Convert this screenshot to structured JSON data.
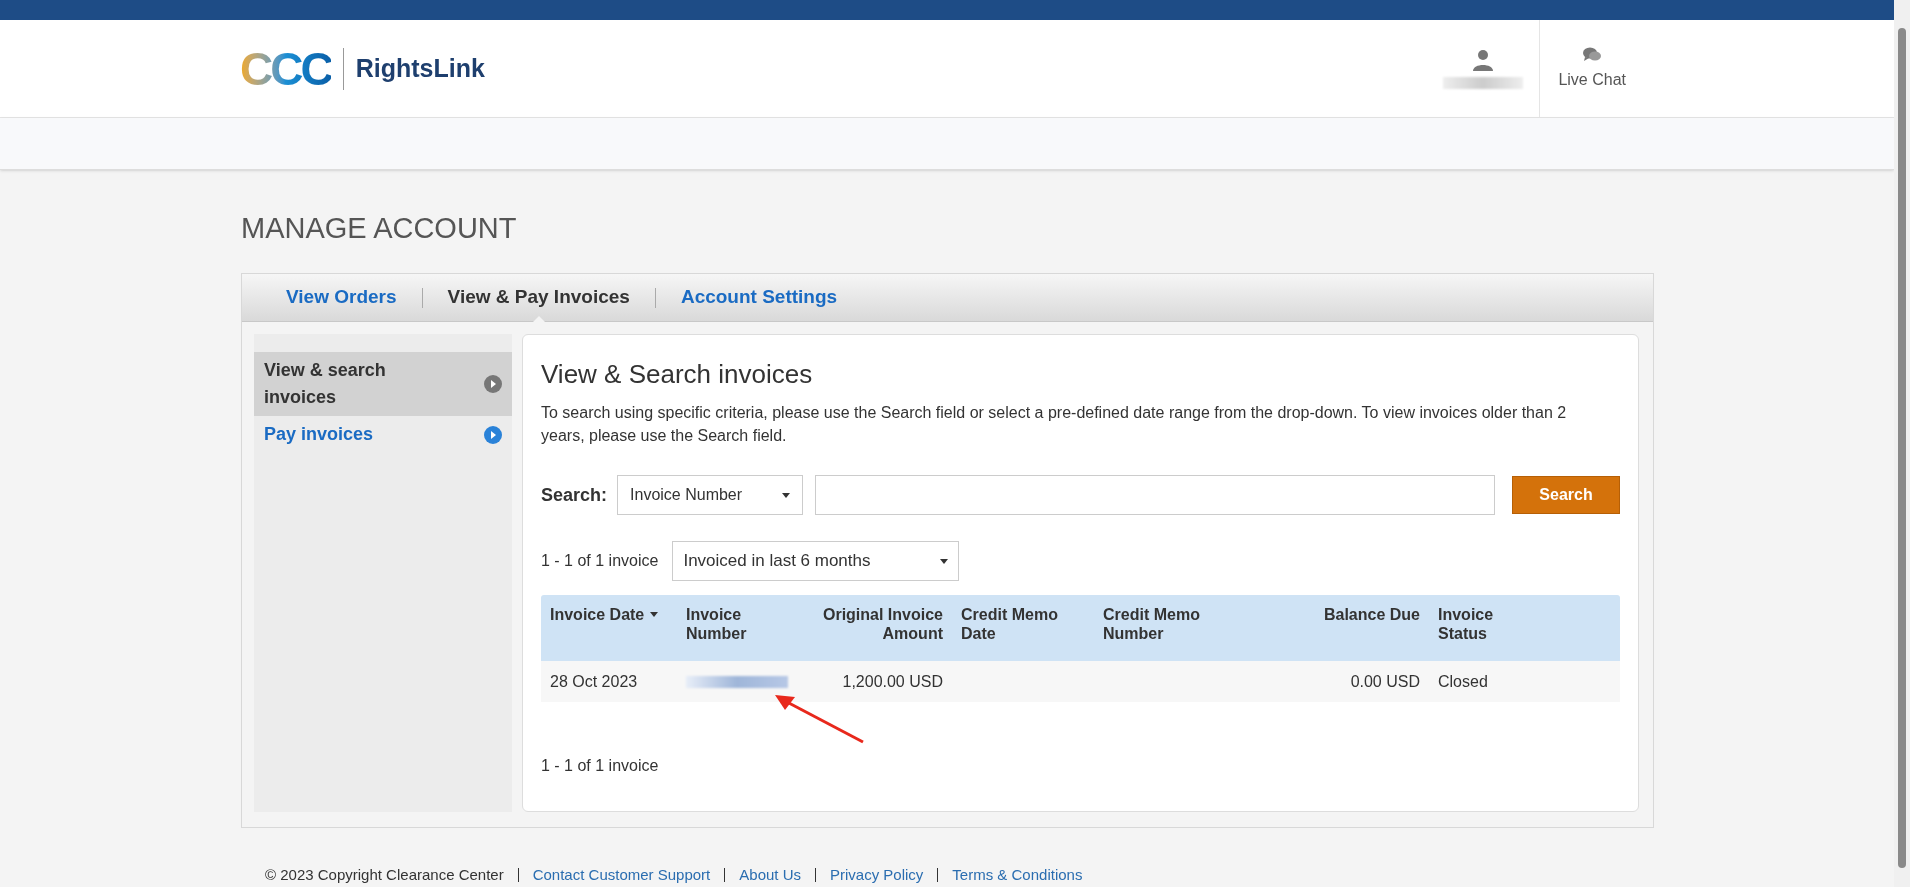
{
  "header": {
    "logo": {
      "mark": "CCC",
      "name": "RightsLink"
    },
    "user_menu": {
      "redacted": true
    },
    "live_chat": "Live Chat"
  },
  "page_title": "MANAGE ACCOUNT",
  "tabs": [
    {
      "label": "View Orders",
      "selected": false
    },
    {
      "label": "View & Pay Invoices",
      "selected": true
    },
    {
      "label": "Account Settings",
      "selected": false
    }
  ],
  "sidebar": {
    "items": [
      {
        "label": "View & search invoices",
        "selected": true
      },
      {
        "label": "Pay invoices",
        "selected": false
      }
    ]
  },
  "content": {
    "title": "View & Search invoices",
    "intro": "To search using specific criteria, please use the Search field or select a pre-defined date range from the drop-down. To view invoices older than 2 years, please use the Search field.",
    "search": {
      "label": "Search:",
      "field_select": "Invoice Number",
      "button": "Search"
    },
    "count_top": "1 - 1 of 1 invoice",
    "range_select": "Invoiced in last 6 months",
    "table": {
      "columns": [
        {
          "label": "Invoice Date",
          "kind": "text",
          "sorted": true
        },
        {
          "label": "Invoice Number",
          "kind": "text",
          "sorted": false
        },
        {
          "label": "Original Invoice Amount",
          "kind": "money",
          "sorted": false
        },
        {
          "label": "Credit Memo Date",
          "kind": "text",
          "sorted": false
        },
        {
          "label": "Credit Memo Number",
          "kind": "text",
          "sorted": false
        },
        {
          "label": "Balance Due",
          "kind": "money",
          "sorted": false
        },
        {
          "label": "Invoice Status",
          "kind": "text",
          "sorted": false
        }
      ],
      "rows": [
        {
          "cells": [
            {
              "text": "28 Oct 2023"
            },
            {
              "kind": "redacted"
            },
            {
              "text": "1,200.00 USD"
            },
            {
              "kind": "empty"
            },
            {
              "kind": "empty"
            },
            {
              "text": "0.00 USD"
            },
            {
              "text": "Closed"
            }
          ]
        }
      ]
    },
    "count_bottom": "1 - 1 of 1 invoice"
  },
  "footer": {
    "copyright": "© 2023 Copyright Clearance Center",
    "links": [
      "Contact Customer Support",
      "About Us",
      "Privacy Policy",
      "Terms & Conditions"
    ]
  }
}
